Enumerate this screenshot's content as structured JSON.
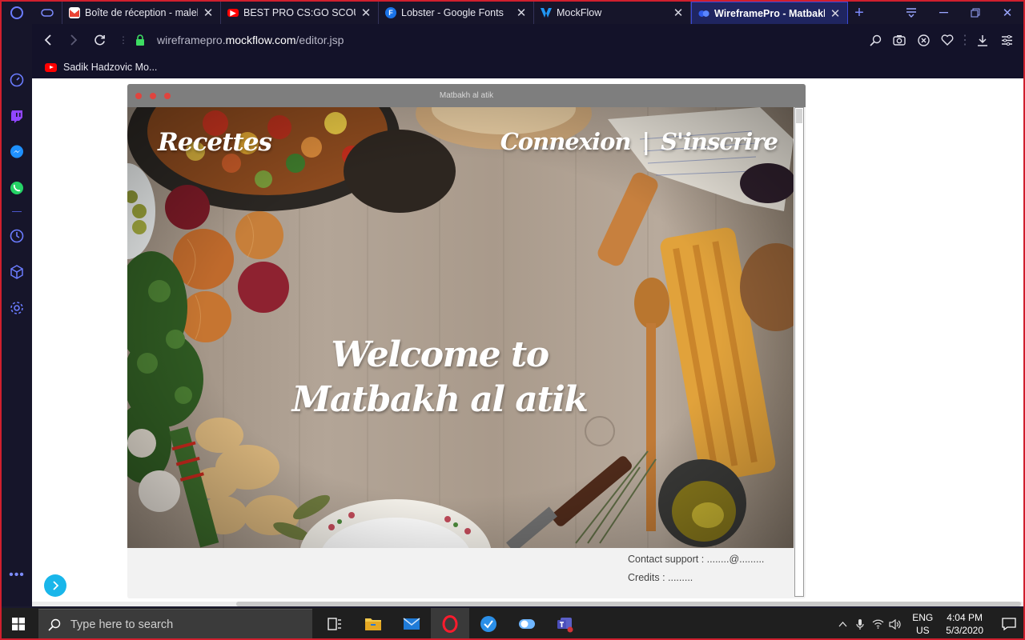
{
  "browser": {
    "tabs": [
      {
        "title": "Boîte de réception - maleka",
        "favicon": "gmail-icon",
        "favicon_color": "#ea4335"
      },
      {
        "title": "BEST PRO CS:GO SCOUT PL",
        "favicon": "youtube-icon",
        "favicon_color": "#ff0000"
      },
      {
        "title": "Lobster - Google Fonts",
        "favicon": "google-fonts-icon",
        "favicon_color": "#1a73e8"
      },
      {
        "title": "MockFlow",
        "favicon": "mockflow-icon",
        "favicon_color": "#2196f3"
      },
      {
        "title": "WireframePro - Matbakh al atik",
        "favicon": "wireframepro-icon",
        "favicon_color": "#3a6cf5",
        "active": true
      }
    ],
    "url": {
      "prefix": "wireframepro.",
      "domain": "mockflow.com",
      "path": "/editor.jsp"
    },
    "bookmarks": [
      {
        "label": "Sadik Hadzovic Mo...",
        "icon": "youtube-icon"
      }
    ],
    "accent": "#6b7cff"
  },
  "preview": {
    "window_title": "Matbakh al atik",
    "nav": {
      "recettes": "Recettes",
      "connexion": "Connexion",
      "separator": "|",
      "inscrire": "S'inscrire"
    },
    "hero_title": "Welcome to Matbakh al atik",
    "footer": {
      "contact": "Contact support : ........@.........",
      "credits": "Credits : ........."
    }
  },
  "taskbar": {
    "search_placeholder": "Type here to search",
    "language": {
      "line1": "ENG",
      "line2": "US"
    },
    "time": "4:04 PM",
    "date": "5/3/2020"
  }
}
